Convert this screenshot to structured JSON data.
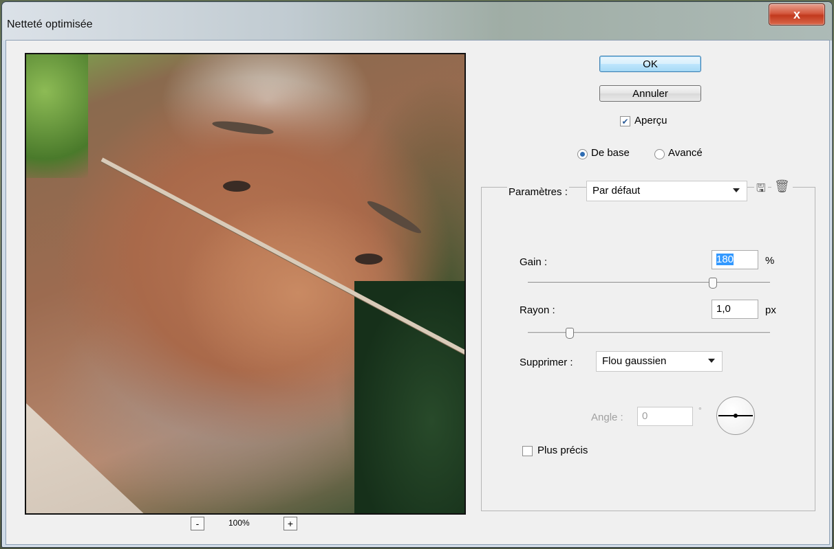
{
  "window": {
    "title": "Netteté optimisée",
    "close_symbol": "x"
  },
  "buttons": {
    "ok": "OK",
    "cancel": "Annuler"
  },
  "preview_check": {
    "label": "Aperçu",
    "checked": true
  },
  "mode": {
    "basic": "De base",
    "advanced": "Avancé",
    "selected": "basic"
  },
  "params": {
    "label": "Paramètres :",
    "value": "Par défaut"
  },
  "gain": {
    "label": "Gain :",
    "value": "180",
    "unit": "%",
    "slider_fraction": 0.76
  },
  "radius": {
    "label": "Rayon :",
    "value": "1,0",
    "unit": "px",
    "slider_fraction": 0.17
  },
  "remove": {
    "label": "Supprimer :",
    "value": "Flou gaussien"
  },
  "angle": {
    "label": "Angle :",
    "value": "0",
    "unit": "°"
  },
  "more_accurate": {
    "label": "Plus précis",
    "checked": false
  },
  "zoom": {
    "minus": "-",
    "value": "100%",
    "plus": "+"
  },
  "icons": {
    "save_preset": "save-preset-icon",
    "delete_preset": "trash-icon"
  }
}
